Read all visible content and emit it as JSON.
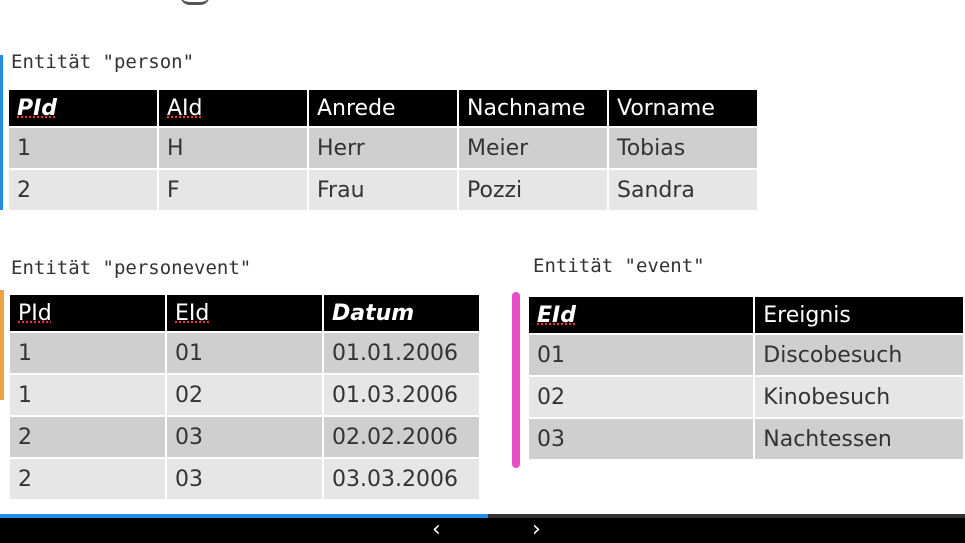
{
  "labels": {
    "person": "Entität \"person\"",
    "personevent": "Entität \"personevent\"",
    "event": "Entität \"event\""
  },
  "person": {
    "headers": [
      "PId",
      "AId",
      "Anrede",
      "Nachname",
      "Vorname"
    ],
    "rows": [
      [
        "1",
        "H",
        "Herr",
        "Meier",
        "Tobias"
      ],
      [
        "2",
        "F",
        "Frau",
        "Pozzi",
        "Sandra"
      ]
    ]
  },
  "personevent": {
    "headers": [
      "PId",
      "EId",
      "Datum"
    ],
    "rows": [
      [
        "1",
        "01",
        "01.01.2006"
      ],
      [
        "1",
        "02",
        "01.03.2006"
      ],
      [
        "2",
        "03",
        "02.02.2006"
      ],
      [
        "2",
        "03",
        "03.03.2006"
      ]
    ]
  },
  "event": {
    "headers": [
      "EId",
      "Ereignis"
    ],
    "rows": [
      [
        "01",
        "Discobesuch"
      ],
      [
        "02",
        "Kinobesuch"
      ],
      [
        "03",
        "Nachtessen"
      ]
    ]
  },
  "nav": {
    "prev": "‹",
    "next": "›"
  },
  "colors": {
    "progress": "#1f8ee8",
    "marker_person": "#1f8ee8",
    "marker_personevent": "#f0a040",
    "marker_event": "#e84dc6"
  },
  "progress_fraction": 0.506
}
